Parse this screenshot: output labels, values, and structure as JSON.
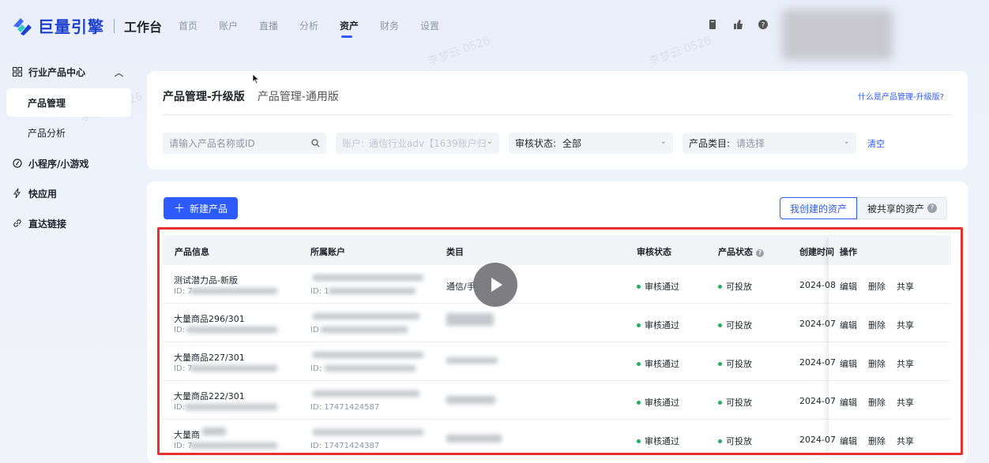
{
  "brand": {
    "logo_text": "巨量引擎",
    "sub_title": "工作台"
  },
  "nav": {
    "items": [
      "首页",
      "账户",
      "直播",
      "分析",
      "资产",
      "财务",
      "设置"
    ],
    "active_index": 4
  },
  "sidebar": {
    "group_industry": "行业产品中心",
    "sub_product_manage": "产品管理",
    "sub_product_analysis": "产品分析",
    "group_mini_program": "小程序/小游戏",
    "group_quick_app": "快应用",
    "group_direct_link": "直达链接"
  },
  "tabs": {
    "upgrade": "产品管理-升级版",
    "general": "产品管理-通用版",
    "help_link": "什么是产品管理-升级版?"
  },
  "filters": {
    "search_placeholder": "请输入产品名称或ID",
    "account_label": "账户:",
    "account_value": "通信行业adv【1639账户归",
    "review_label": "审核状态:",
    "review_value": "全部",
    "category_label": "产品类目:",
    "category_placeholder": "请选择",
    "clear": "清空"
  },
  "toolbar": {
    "new_product": "新建产品",
    "my_assets": "我创建的资产",
    "shared_assets": "被共享的资产"
  },
  "table": {
    "headers": {
      "info": "产品信息",
      "account": "所属账户",
      "category": "类目",
      "review": "审核状态",
      "status": "产品状态",
      "created": "创建时间",
      "ops": "操作"
    },
    "rows": [
      {
        "name": "测试潜力品-新版",
        "id_prefix": "ID: 7",
        "account_prefix": "ID: 1",
        "category_prefix": "通信/手",
        "review": "审核通过",
        "status": "可投放",
        "created": "2024-08"
      },
      {
        "name": "大量商品296/301",
        "id_prefix": "ID:",
        "account_prefix": "ID",
        "category_prefix": "",
        "review": "审核通过",
        "status": "可投放",
        "created": "2024-07"
      },
      {
        "name": "大量商品227/301",
        "id_prefix": "ID: 7",
        "account_prefix": "ID:",
        "category_prefix": "",
        "review": "审核通过",
        "status": "可投放",
        "created": "2024-07"
      },
      {
        "name": "大量商品222/301",
        "id_prefix": "ID:",
        "account_prefix": "ID: 17471424587",
        "category_prefix": "",
        "review": "审核通过",
        "status": "可投放",
        "created": "2024-07"
      },
      {
        "name": "大量商",
        "id_prefix": "ID: 7",
        "account_prefix": "ID: 17471424387",
        "category_prefix": "",
        "review": "审核通过",
        "status": "可投放",
        "created": "2024-07"
      }
    ],
    "ops": {
      "edit": "编辑",
      "delete": "删除",
      "share": "共享"
    }
  },
  "watermark": "李梦云 0526",
  "colors": {
    "accent": "#2e5bff",
    "success": "#20b15a",
    "highlight_box": "#e6322e"
  }
}
